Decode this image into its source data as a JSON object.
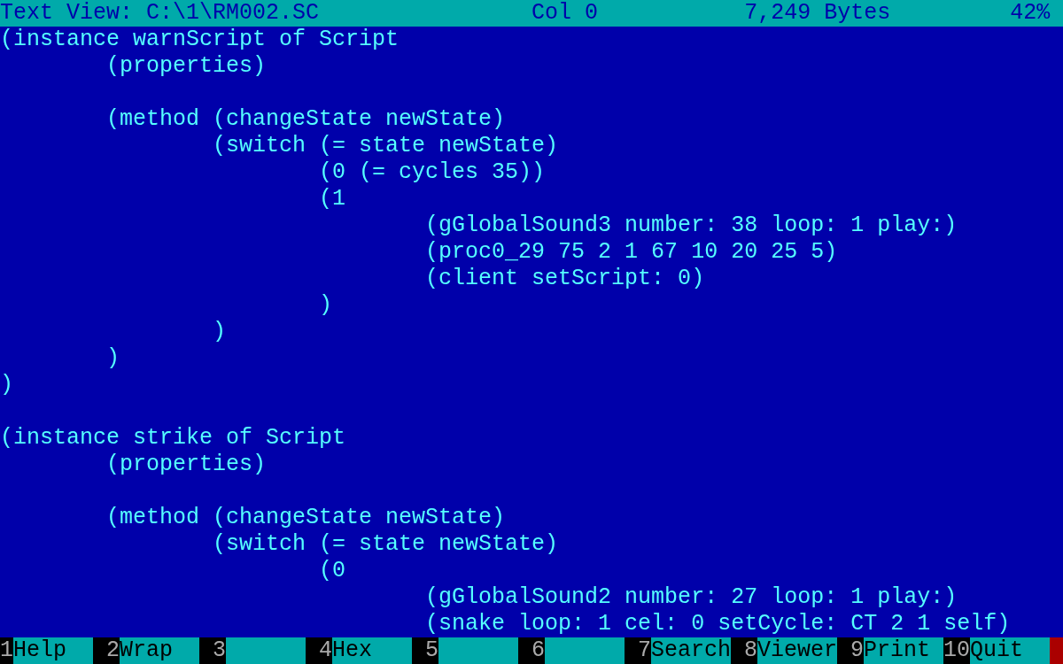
{
  "status_bar": {
    "title": "Text View: C:\\1\\RM002.SC",
    "column": "Col 0",
    "size": "7,249 Bytes",
    "percent": "42%"
  },
  "blocks": [
    [
      "(instance warnScript of Script",
      "\t(properties)"
    ],
    [
      "\t(method (changeState newState)",
      "\t\t(switch (= state newState)",
      "\t\t\t(0 (= cycles 35))",
      "\t\t\t(1",
      "\t\t\t\t(gGlobalSound3 number: 38 loop: 1 play:)",
      "\t\t\t\t(proc0_29 75 2 1 67 10 20 25 5)",
      "\t\t\t\t(client setScript: 0)",
      "\t\t\t)",
      "\t\t)",
      "\t)",
      ")"
    ],
    [
      "(instance strike of Script",
      "\t(properties)"
    ],
    [
      "\t(method (changeState newState)",
      "\t\t(switch (= state newState)",
      "\t\t\t(0",
      "\t\t\t\t(gGlobalSound2 number: 27 loop: 1 play:)",
      "\t\t\t\t(snake loop: 1 cel: 0 setCycle: CT 2 1 self)"
    ]
  ],
  "function_keys": [
    {
      "key": "1",
      "label": "Help"
    },
    {
      "key": "2",
      "label": "Wrap"
    },
    {
      "key": "3"
    },
    {
      "key": "4",
      "label": "Hex"
    },
    {
      "key": "5"
    },
    {
      "key": "6"
    },
    {
      "key": "7",
      "label": "Search"
    },
    {
      "key": "8",
      "label": "Viewer"
    },
    {
      "key": "9",
      "label": "Print"
    },
    {
      "key": "10",
      "label": "Quit"
    }
  ]
}
